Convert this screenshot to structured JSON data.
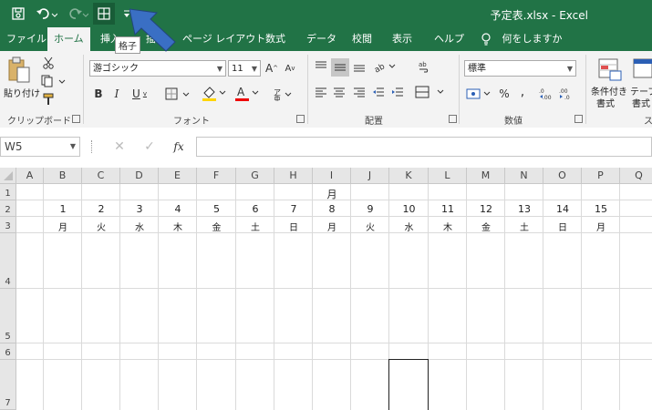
{
  "window": {
    "title": "予定表.xlsx - Excel",
    "tooltip": "格子",
    "qat": {
      "autosave_icon": "save-icon",
      "undo_icon": "undo-icon",
      "redo_icon": "redo-icon",
      "borders_icon": "grid-borders-icon",
      "customize_icon": "qat-customize-icon"
    }
  },
  "ribbon_tabs": [
    "ファイル",
    "ホーム",
    "挿入",
    "描画",
    "ページ レイアウト",
    "数式",
    "データ",
    "校閲",
    "表示",
    "ヘルプ",
    "何をしますか"
  ],
  "ribbon": {
    "clipboard": {
      "paste_label": "貼り付け",
      "group_label": "クリップボード"
    },
    "font": {
      "font_name": "游ゴシック",
      "font_size": "11",
      "group_label": "フォント"
    },
    "alignment": {
      "group_label": "配置"
    },
    "number": {
      "format": "標準",
      "percent": "%",
      "comma": ",",
      "group_label": "数値"
    },
    "styles": {
      "conditional_label_1": "条件付き",
      "conditional_label_2": "書式",
      "table_label_1": "テーブ",
      "table_label_2": "書式",
      "group_label": "ス"
    }
  },
  "formula_bar": {
    "name_box": "W5",
    "fx_label": "fx",
    "value": ""
  },
  "sheet": {
    "columns": [
      "A",
      "B",
      "C",
      "D",
      "E",
      "F",
      "G",
      "H",
      "I",
      "J",
      "K",
      "L",
      "M",
      "N",
      "O",
      "P",
      "Q"
    ],
    "rows": [
      "1",
      "2",
      "3",
      "4",
      "5",
      "6",
      "7"
    ],
    "row1_title": "月",
    "days": [
      "1",
      "2",
      "3",
      "4",
      "5",
      "6",
      "7",
      "8",
      "9",
      "10",
      "11",
      "12",
      "13",
      "14",
      "15"
    ],
    "weekdays": [
      "月",
      "火",
      "水",
      "木",
      "金",
      "土",
      "日",
      "月",
      "火",
      "水",
      "木",
      "金",
      "土",
      "日",
      "月"
    ]
  },
  "colors": {
    "excel_green": "#217346",
    "arrow_blue": "#3a6fc4"
  }
}
